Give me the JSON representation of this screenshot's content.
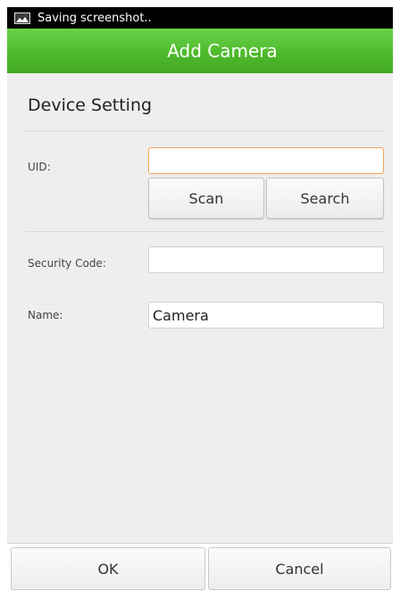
{
  "status_bar": {
    "notification_text": "Saving screenshot..",
    "icon": "image-icon"
  },
  "header": {
    "title": "Add Camera",
    "color": "#4fba2d"
  },
  "device_setting": {
    "section_title": "Device Setting",
    "uid": {
      "label": "UID:",
      "value": ""
    },
    "scan_label": "Scan",
    "search_label": "Search",
    "security_code": {
      "label": "Security Code:",
      "value": ""
    },
    "name": {
      "label": "Name:",
      "value": "Camera"
    }
  },
  "footer": {
    "ok_label": "OK",
    "cancel_label": "Cancel"
  },
  "colors": {
    "accent_green": "#4fba2d",
    "focus_orange": "#f2a555",
    "background": "#eeeeee"
  }
}
